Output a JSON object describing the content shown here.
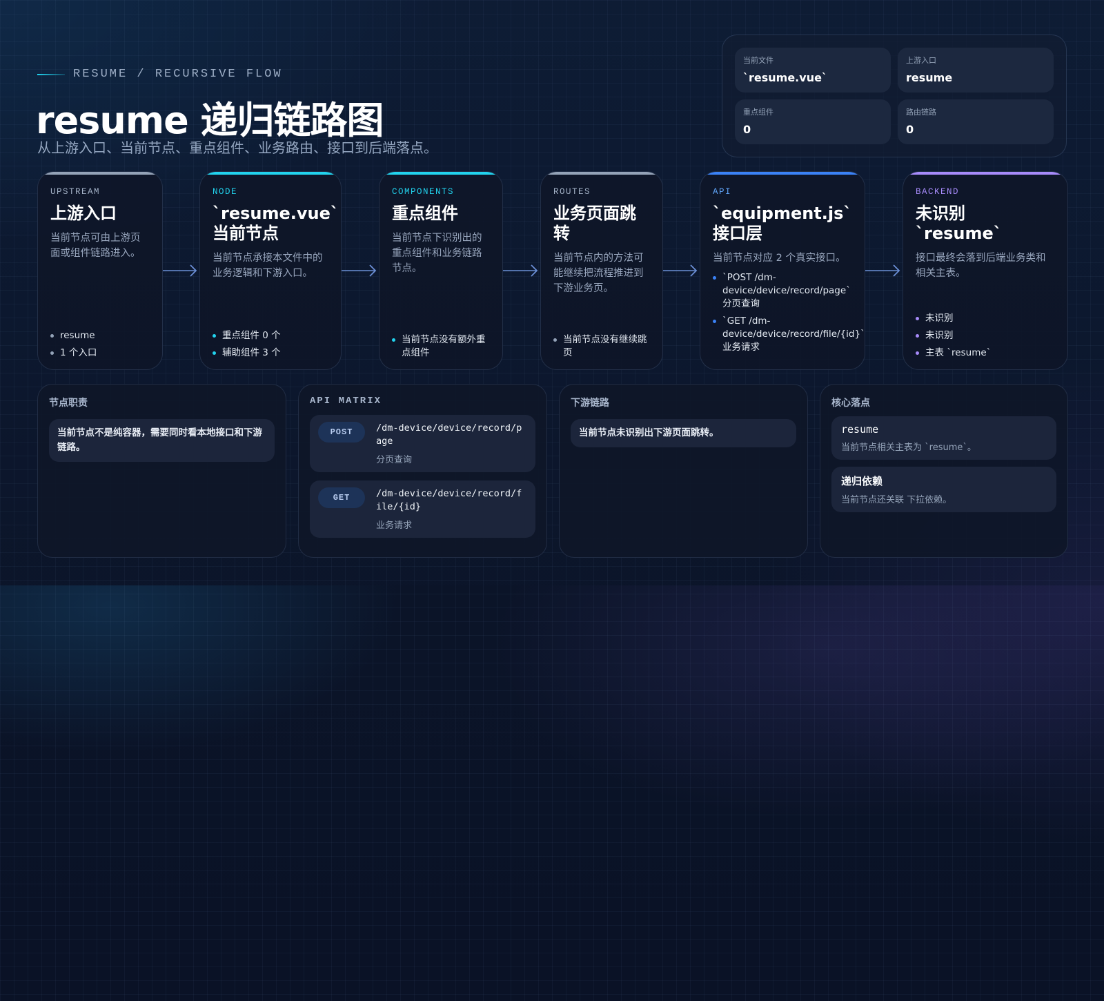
{
  "header": {
    "eyebrow": "RESUME / RECURSIVE FLOW",
    "title": "resume 递归链路图",
    "subtitle": "从上游入口、当前节点、重点组件、业务路由、接口到后端落点。"
  },
  "stats": [
    {
      "label": "当前文件",
      "value": "`resume.vue`"
    },
    {
      "label": "上游入口",
      "value": "resume"
    },
    {
      "label": "重点组件",
      "value": "0"
    },
    {
      "label": "路由链路",
      "value": "0"
    }
  ],
  "cards": {
    "upstream": {
      "tag": "UPSTREAM",
      "title": "上游入口",
      "desc": "当前节点可由上游页面或组件链路进入。",
      "items": [
        "resume",
        "1 个入口"
      ]
    },
    "node": {
      "tag": "NODE",
      "title": "`resume.vue` 当前节点",
      "desc": "当前节点承接本文件中的业务逻辑和下游入口。",
      "items": [
        "重点组件 0 个",
        "辅助组件 3 个"
      ]
    },
    "components": {
      "tag": "COMPONENTS",
      "title": "重点组件",
      "desc": "当前节点下识别出的重点组件和业务链路节点。",
      "items": [
        "当前节点没有额外重点组件"
      ]
    },
    "routes": {
      "tag": "ROUTES",
      "title": "业务页面跳转",
      "desc": "当前节点内的方法可能继续把流程推进到下游业务页。",
      "items": [
        "当前节点没有继续跳页"
      ]
    },
    "api": {
      "tag": "API",
      "title": "`equipment.js` 接口层",
      "desc": "当前节点对应 2 个真实接口。",
      "items": [
        "`POST /dm-device/device/record/page` 分页查询",
        "`GET /dm-device/device/record/file/{id}` 业务请求"
      ]
    },
    "backend": {
      "tag": "BACKEND",
      "title": "未识别 `resume`",
      "desc": "接口最终会落到后端业务类和相关主表。",
      "items": [
        "未识别",
        "未识别",
        "主表 `resume`"
      ]
    }
  },
  "panels": {
    "duty": {
      "title": "节点职责",
      "text": "当前节点不是纯容器，需要同时看本地接口和下游链路。"
    },
    "matrix": {
      "title": "API MATRIX",
      "rows": [
        {
          "method": "POST",
          "path": "/dm-device/device/record/page",
          "desc": "分页查询"
        },
        {
          "method": "GET",
          "path": "/dm-device/device/record/file/{id}",
          "desc": "业务请求"
        }
      ]
    },
    "downstream": {
      "title": "下游链路",
      "text": "当前节点未识别出下游页面跳转。"
    },
    "core": {
      "title": "核心落点",
      "items": [
        {
          "title": "resume",
          "desc": "当前节点相关主表为 `resume`。"
        },
        {
          "title": "递归依赖",
          "desc": "当前节点还关联 下拉依赖。"
        }
      ]
    }
  },
  "colors": {
    "upstream": "#94a3b8",
    "node": "#22d3ee",
    "components": "#22d3ee",
    "routes": "#94a3b8",
    "api": "#3b82f6",
    "backend": "#a78bfa",
    "arrow": "#6b8fd6"
  },
  "icons": {
    "flow_arrow": "chevron-right-arrow-icon"
  }
}
